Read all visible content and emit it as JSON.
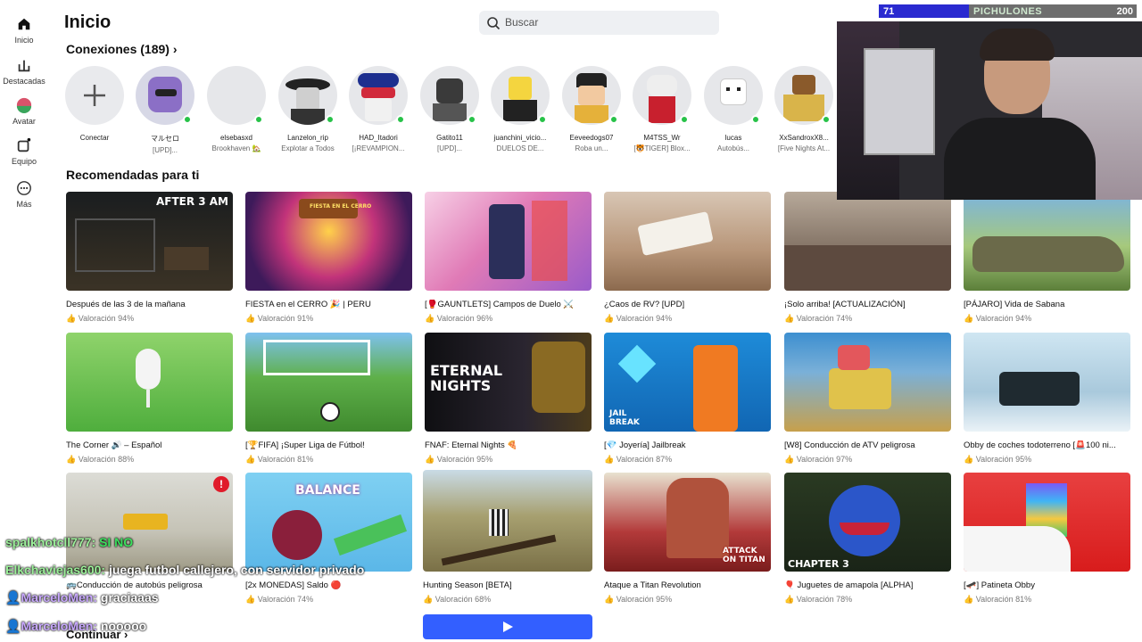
{
  "sidebar": {
    "items": [
      {
        "label": "Inicio",
        "icon": "home-icon"
      },
      {
        "label": "Destacadas",
        "icon": "chart-icon"
      },
      {
        "label": "Avatar",
        "icon": "avatar-icon"
      },
      {
        "label": "Equipo",
        "icon": "team-icon"
      },
      {
        "label": "Más",
        "icon": "more-icon"
      }
    ]
  },
  "header": {
    "title": "Inicio",
    "search_placeholder": "Buscar"
  },
  "connections": {
    "title": "Conexiones (189)",
    "friends": [
      {
        "name": "Conectar",
        "sub": ""
      },
      {
        "name": "マルセロ",
        "sub": "[UPD]..."
      },
      {
        "name": "elsebasxd",
        "sub": "Brookhaven 🏡"
      },
      {
        "name": "Lanzelon_rip",
        "sub": "Explotar a Todos"
      },
      {
        "name": "HAD_Itadori",
        "sub": "[¡REVAMPION..."
      },
      {
        "name": "Gatito11",
        "sub": "[UPD]..."
      },
      {
        "name": "juanchini_vicio...",
        "sub": "DUELOS DE..."
      },
      {
        "name": "Eeveedogs07",
        "sub": "Roba un..."
      },
      {
        "name": "M4TSS_Wr",
        "sub": "[🐯TIGER] Blox..."
      },
      {
        "name": "lucas",
        "sub": "Autobús..."
      },
      {
        "name": "XxSandroxX8...",
        "sub": "[Five Nights At..."
      }
    ]
  },
  "recommended": {
    "title": "Recomendadas para ti",
    "games": [
      {
        "title": "Después de las 3 de la mañana",
        "rating": "Valoración 94%",
        "thumb_text": "AFTER 3 AM"
      },
      {
        "title": "FIESTA en el CERRO 🎉 | PERU",
        "rating": "Valoración 91%",
        "thumb_text": "FIESTA EN EL CERRO"
      },
      {
        "title": "[🥊GAUNTLETS] Campos de Duelo ⚔️",
        "rating": "Valoración 96%",
        "thumb_text": ""
      },
      {
        "title": "¿Caos de RV? [UPD]",
        "rating": "Valoración 94%",
        "thumb_text": ""
      },
      {
        "title": "¡Solo arriba! [ACTUALIZACIÓN]",
        "rating": "Valoración 74%",
        "thumb_text": ""
      },
      {
        "title": "[PÁJARO] Vida de Sabana",
        "rating": "Valoración 94%",
        "thumb_text": ""
      },
      {
        "title": "The Corner 🔊 – Español",
        "rating": "Valoración 88%",
        "thumb_text": ""
      },
      {
        "title": "[🏆FIFA] ¡Super Liga de Fútbol!",
        "rating": "Valoración 81%",
        "thumb_text": ""
      },
      {
        "title": "FNAF: Eternal Nights 🍕",
        "rating": "Valoración 95%",
        "thumb_text": "ETERNAL NIGHTS"
      },
      {
        "title": "[💎 Joyería] Jailbreak",
        "rating": "Valoración 87%",
        "thumb_text": "JAIL BREAK"
      },
      {
        "title": "[W8] Conducción de ATV peligrosa",
        "rating": "Valoración 97%",
        "thumb_text": ""
      },
      {
        "title": "Obby de coches todoterreno [🚨100 ni...",
        "rating": "Valoración 95%",
        "thumb_text": ""
      },
      {
        "title": "🚌Conducción de autobús peligrosa",
        "rating": "",
        "thumb_text": ""
      },
      {
        "title": "[2x MONEDAS] Saldo 🔴",
        "rating": "Valoración 74%",
        "thumb_text": "BALANCE"
      },
      {
        "title": "Hunting Season [BETA]",
        "rating": "Valoración 68%",
        "thumb_text": ""
      },
      {
        "title": "Ataque a Titan Revolution",
        "rating": "Valoración 95%",
        "thumb_text": "ATTACK ON TITAN"
      },
      {
        "title": "🎈 Juguetes de amapola [ALPHA]",
        "rating": "Valoración 78%",
        "thumb_text": "CHAPTER 3"
      },
      {
        "title": "[🛹] Patineta Obby",
        "rating": "Valoración 81%",
        "thumb_text": ""
      }
    ]
  },
  "continue_label": "Continuar",
  "overlay": {
    "score_left": "71",
    "score_name": "PICHULONES",
    "score_right": "200",
    "chat": [
      {
        "user": "spalkhotcll777:",
        "msg": "SI NO"
      },
      {
        "user": "Elkchaviejas600:",
        "msg": "juega futbol callejero, con servidor privado"
      },
      {
        "user": "MarceloMen:",
        "msg": "graciaaas"
      },
      {
        "user": "MarceloMen:",
        "msg": "nooooo"
      }
    ]
  },
  "colors": {
    "online": "#27c248",
    "accent": "#335fff"
  }
}
